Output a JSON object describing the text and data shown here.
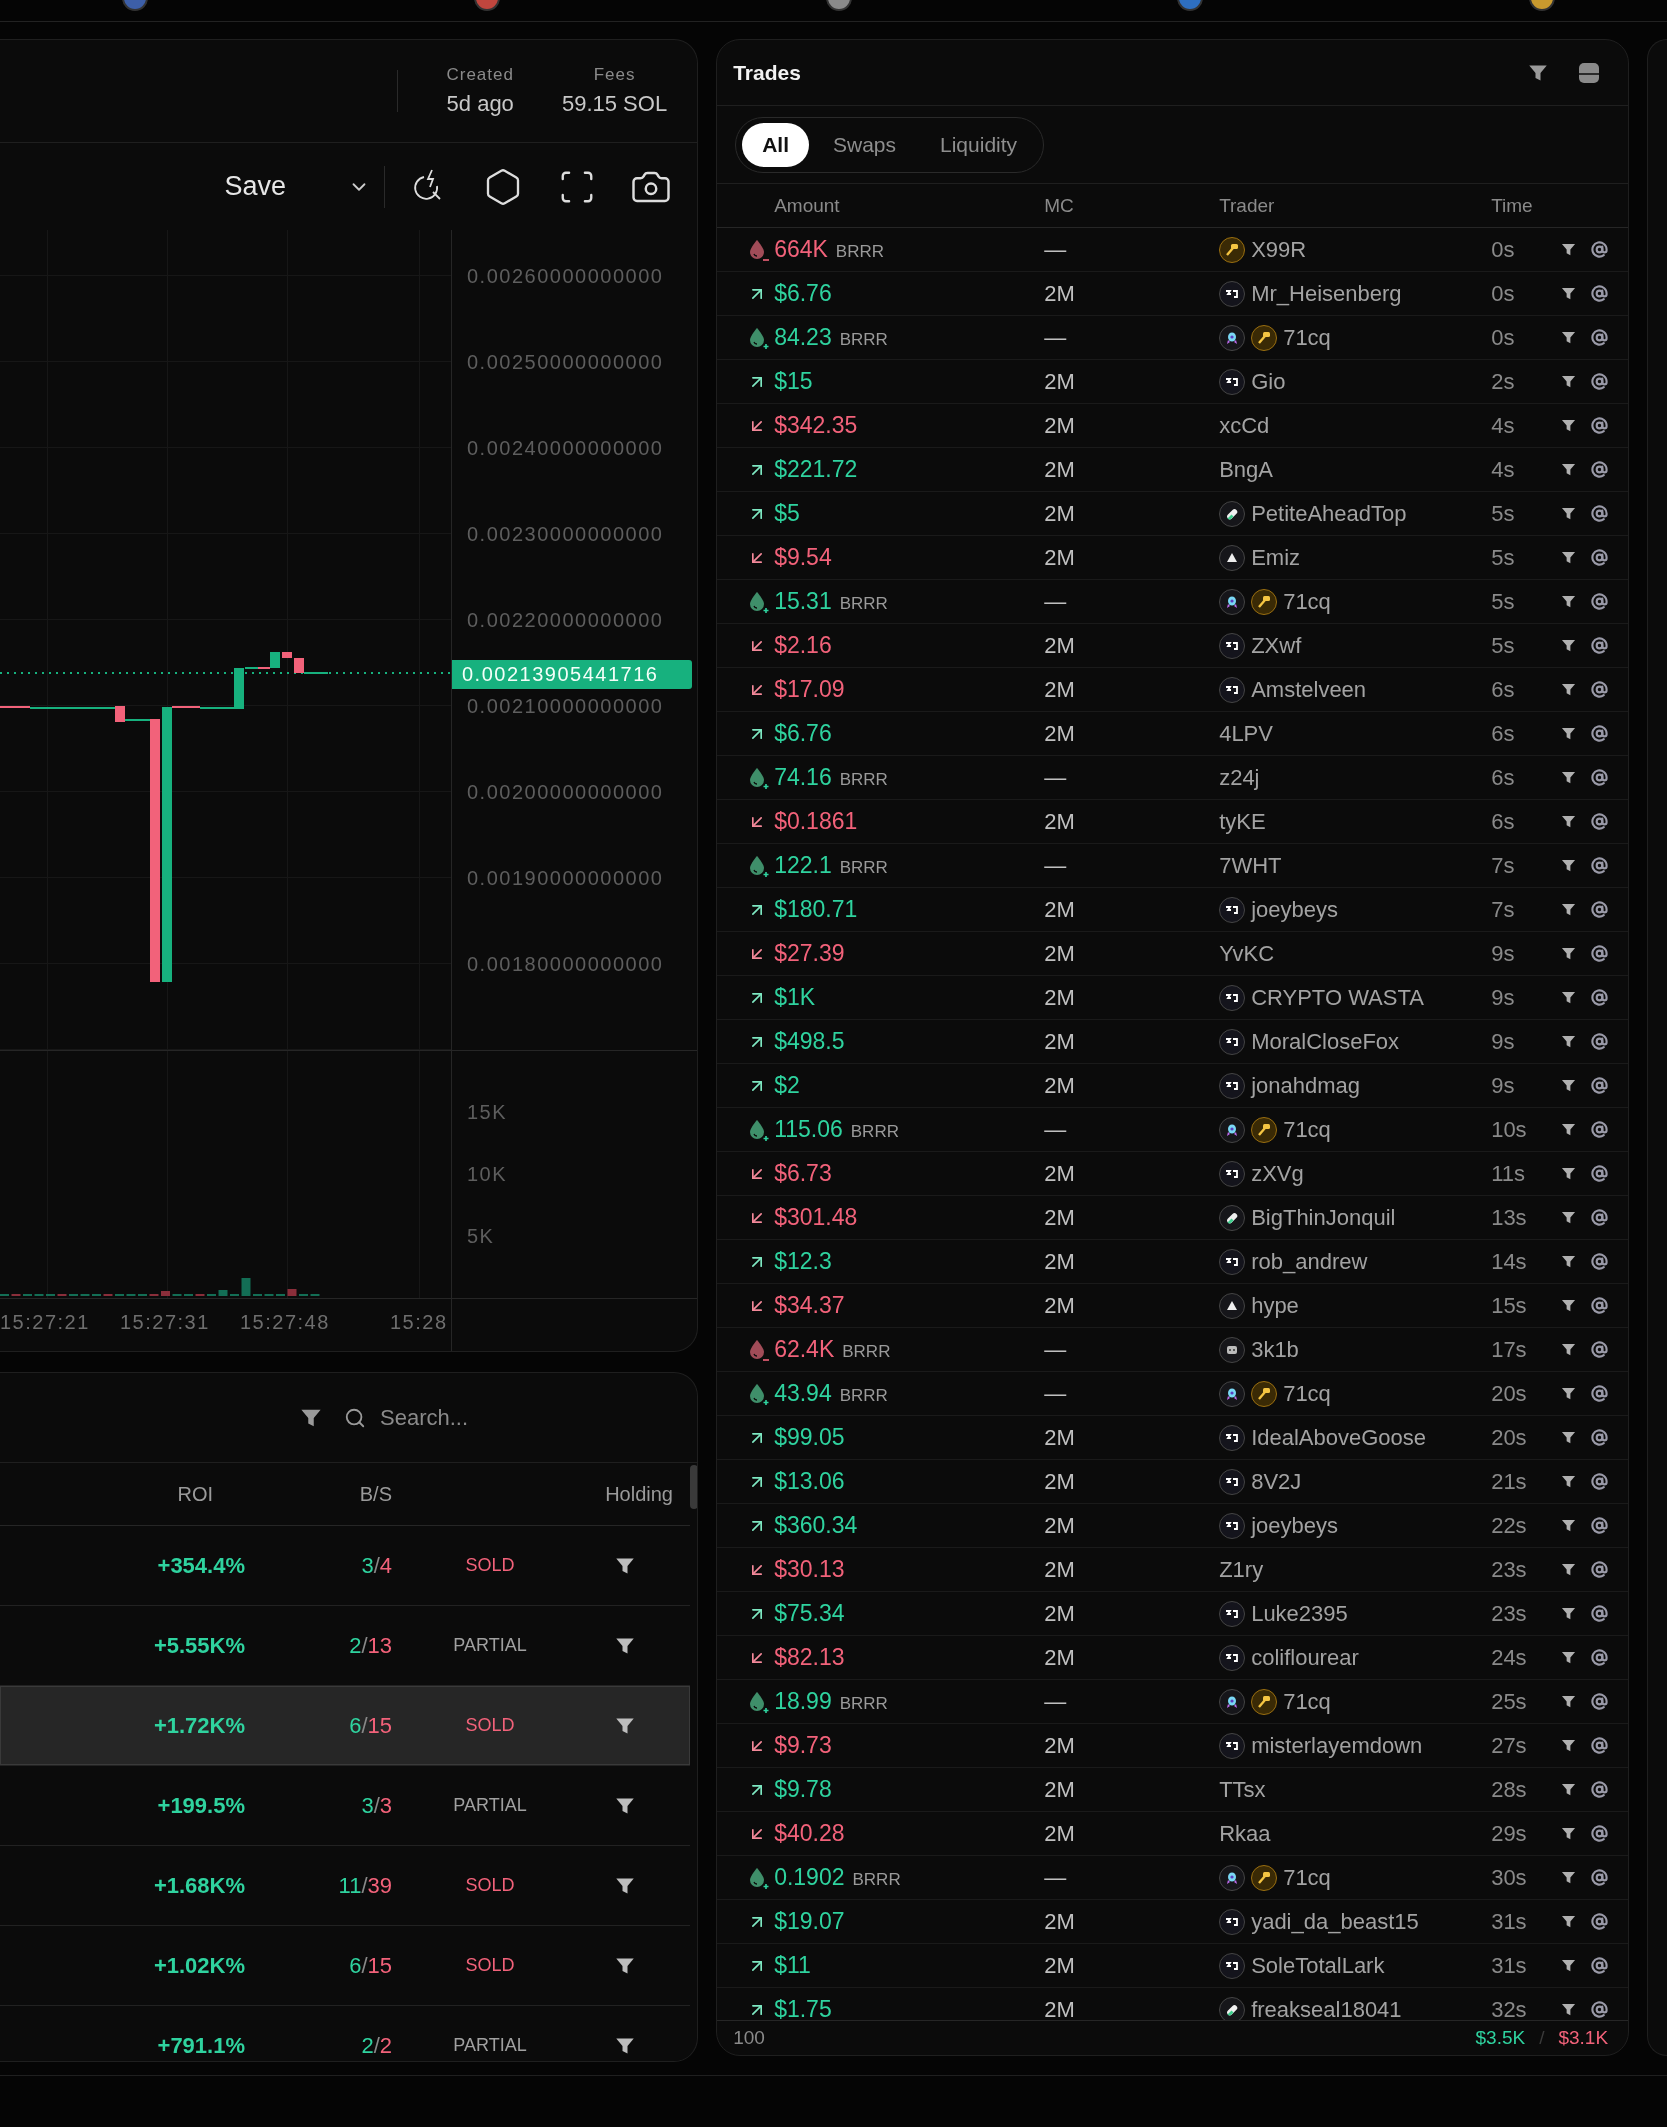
{
  "top_bar": {
    "token_icons": [
      {
        "color": "#3d5fa8"
      },
      {
        "color": "#c0463e"
      },
      {
        "color": "#8a8a8a"
      },
      {
        "color": "#2e6fc0"
      },
      {
        "color": "#c99a2e"
      }
    ]
  },
  "chart_header": {
    "stats": [
      {
        "label": "Created",
        "value": "5d ago"
      },
      {
        "label": "Fees",
        "value": "59.15 SOL"
      }
    ]
  },
  "chart_toolbar": {
    "save_label": "Save"
  },
  "price_chart": {
    "price_ticks": [
      "0.00260000000000",
      "0.00250000000000",
      "0.00240000000000",
      "0.00230000000000",
      "0.00220000000000",
      "0.00210000000000",
      "0.00200000000000",
      "0.00190000000000",
      "0.00180000000000"
    ],
    "current_price": "0.00213905441716",
    "volume_ticks": [
      "15K",
      "10K",
      "5K"
    ],
    "time_ticks": [
      "15:27:21",
      "15:27:31",
      "15:27:48",
      "15:28"
    ]
  },
  "holders": {
    "search": {
      "placeholder": "Search..."
    },
    "columns": [
      "ROI",
      "B/S",
      "Holding"
    ],
    "rows": [
      {
        "roi": "+354.4%",
        "buys": "3",
        "separator": "/",
        "sells": "4",
        "kind": "sold",
        "status": "SOLD",
        "highlighted": false
      },
      {
        "roi": "+5.55K%",
        "buys": "2",
        "separator": "/",
        "sells": "13",
        "kind": "partial",
        "status": "PARTIAL",
        "highlighted": false
      },
      {
        "roi": "+1.72K%",
        "buys": "6",
        "separator": "/",
        "sells": "15",
        "kind": "sold",
        "status": "SOLD",
        "highlighted": true
      },
      {
        "roi": "+199.5%",
        "buys": "3",
        "separator": "/",
        "sells": "3",
        "kind": "partial",
        "status": "PARTIAL",
        "highlighted": false
      },
      {
        "roi": "+1.68K%",
        "buys": "11",
        "separator": "/",
        "sells": "39",
        "kind": "sold",
        "status": "SOLD",
        "highlighted": false
      },
      {
        "roi": "+1.02K%",
        "buys": "6",
        "separator": "/",
        "sells": "15",
        "kind": "sold",
        "status": "SOLD",
        "highlighted": false
      },
      {
        "roi": "+791.1%",
        "buys": "2",
        "separator": "/",
        "sells": "2",
        "kind": "partial",
        "status": "PARTIAL",
        "highlighted": false
      }
    ]
  },
  "trades": {
    "title": "Trades",
    "tabs": [
      {
        "label": "All",
        "selected": true
      },
      {
        "label": "Swaps",
        "selected": false
      },
      {
        "label": "Liquidity",
        "selected": false
      }
    ],
    "columns": [
      "Amount",
      "MC",
      "Trader",
      "Time"
    ],
    "rows": [
      {
        "kind": "remove",
        "amount": "664K",
        "unit": "BRRR",
        "mc": "—",
        "badges": [
          {
            "kind": "key"
          }
        ],
        "trader": "X99R",
        "time": "0s"
      },
      {
        "kind": "buy",
        "amount": "$6.76",
        "mc": "2M",
        "badges": [
          {
            "kind": "pump"
          }
        ],
        "trader": "Mr_Heisenberg",
        "time": "0s"
      },
      {
        "kind": "add",
        "amount": "84.23",
        "unit": "BRRR",
        "mc": "—",
        "badges": [
          {
            "kind": "rocket"
          },
          {
            "kind": "key"
          }
        ],
        "trader": "71cq",
        "time": "0s"
      },
      {
        "kind": "buy",
        "amount": "$15",
        "mc": "2M",
        "badges": [
          {
            "kind": "pump"
          }
        ],
        "trader": "Gio",
        "time": "2s"
      },
      {
        "kind": "sell",
        "amount": "$342.35",
        "mc": "2M",
        "badges": [],
        "trader": "xcCd",
        "time": "4s"
      },
      {
        "kind": "buy",
        "amount": "$221.72",
        "mc": "2M",
        "badges": [],
        "trader": "BngA",
        "time": "4s"
      },
      {
        "kind": "buy",
        "amount": "$5",
        "mc": "2M",
        "badges": [
          {
            "kind": "pill"
          }
        ],
        "trader": "PetiteAheadTop",
        "time": "5s"
      },
      {
        "kind": "sell",
        "amount": "$9.54",
        "mc": "2M",
        "badges": [
          {
            "kind": "triangle"
          }
        ],
        "trader": "Emiz",
        "time": "5s"
      },
      {
        "kind": "add",
        "amount": "15.31",
        "unit": "BRRR",
        "mc": "—",
        "badges": [
          {
            "kind": "rocket"
          },
          {
            "kind": "key"
          }
        ],
        "trader": "71cq",
        "time": "5s"
      },
      {
        "kind": "sell",
        "amount": "$2.16",
        "mc": "2M",
        "badges": [
          {
            "kind": "pump"
          }
        ],
        "trader": "ZXwf",
        "time": "5s"
      },
      {
        "kind": "sell",
        "amount": "$17.09",
        "mc": "2M",
        "badges": [
          {
            "kind": "pump"
          }
        ],
        "trader": "Amstelveen",
        "time": "6s"
      },
      {
        "kind": "buy",
        "amount": "$6.76",
        "mc": "2M",
        "badges": [],
        "trader": "4LPV",
        "time": "6s"
      },
      {
        "kind": "add",
        "amount": "74.16",
        "unit": "BRRR",
        "mc": "—",
        "badges": [],
        "trader": "z24j",
        "time": "6s"
      },
      {
        "kind": "sell",
        "amount": "$0.1861",
        "mc": "2M",
        "badges": [],
        "trader": "tyKE",
        "time": "6s"
      },
      {
        "kind": "add",
        "amount": "122.1",
        "unit": "BRRR",
        "mc": "—",
        "badges": [],
        "trader": "7WHT",
        "time": "7s"
      },
      {
        "kind": "buy",
        "amount": "$180.71",
        "mc": "2M",
        "badges": [
          {
            "kind": "pump"
          }
        ],
        "trader": "joeybeys",
        "time": "7s"
      },
      {
        "kind": "sell",
        "amount": "$27.39",
        "mc": "2M",
        "badges": [],
        "trader": "YvKC",
        "time": "9s"
      },
      {
        "kind": "buy",
        "amount": "$1K",
        "mc": "2M",
        "badges": [
          {
            "kind": "pump"
          }
        ],
        "trader": "CRYPTO WASTA",
        "time": "9s"
      },
      {
        "kind": "buy",
        "amount": "$498.5",
        "mc": "2M",
        "badges": [
          {
            "kind": "pump"
          }
        ],
        "trader": "MoralCloseFox",
        "time": "9s"
      },
      {
        "kind": "buy",
        "amount": "$2",
        "mc": "2M",
        "badges": [
          {
            "kind": "pump"
          }
        ],
        "trader": "jonahdmag",
        "time": "9s"
      },
      {
        "kind": "add",
        "amount": "115.06",
        "unit": "BRRR",
        "mc": "—",
        "badges": [
          {
            "kind": "rocket"
          },
          {
            "kind": "key"
          }
        ],
        "trader": "71cq",
        "time": "10s"
      },
      {
        "kind": "sell",
        "amount": "$6.73",
        "mc": "2M",
        "badges": [
          {
            "kind": "pump"
          }
        ],
        "trader": "zXVg",
        "time": "11s"
      },
      {
        "kind": "sell",
        "amount": "$301.48",
        "mc": "2M",
        "badges": [
          {
            "kind": "pill"
          }
        ],
        "trader": "BigThinJonquil",
        "time": "13s"
      },
      {
        "kind": "buy",
        "amount": "$12.3",
        "mc": "2M",
        "badges": [
          {
            "kind": "pump"
          }
        ],
        "trader": "rob_andrew",
        "time": "14s"
      },
      {
        "kind": "sell",
        "amount": "$34.37",
        "mc": "2M",
        "badges": [
          {
            "kind": "triangle"
          }
        ],
        "trader": "hype",
        "time": "15s"
      },
      {
        "kind": "remove",
        "amount": "62.4K",
        "unit": "BRRR",
        "mc": "—",
        "badges": [
          {
            "kind": "robot"
          }
        ],
        "trader": "3k1b",
        "time": "17s"
      },
      {
        "kind": "add",
        "amount": "43.94",
        "unit": "BRRR",
        "mc": "—",
        "badges": [
          {
            "kind": "rocket"
          },
          {
            "kind": "key"
          }
        ],
        "trader": "71cq",
        "time": "20s"
      },
      {
        "kind": "buy",
        "amount": "$99.05",
        "mc": "2M",
        "badges": [
          {
            "kind": "pump"
          }
        ],
        "trader": "IdealAboveGoose",
        "time": "20s"
      },
      {
        "kind": "buy",
        "amount": "$13.06",
        "mc": "2M",
        "badges": [
          {
            "kind": "pump"
          }
        ],
        "trader": "8V2J",
        "time": "21s"
      },
      {
        "kind": "buy",
        "amount": "$360.34",
        "mc": "2M",
        "badges": [
          {
            "kind": "pump"
          }
        ],
        "trader": "joeybeys",
        "time": "22s"
      },
      {
        "kind": "sell",
        "amount": "$30.13",
        "mc": "2M",
        "badges": [],
        "trader": "Z1ry",
        "time": "23s"
      },
      {
        "kind": "buy",
        "amount": "$75.34",
        "mc": "2M",
        "badges": [
          {
            "kind": "pump"
          }
        ],
        "trader": "Luke2395",
        "time": "23s"
      },
      {
        "kind": "sell",
        "amount": "$82.13",
        "mc": "2M",
        "badges": [
          {
            "kind": "pump"
          }
        ],
        "trader": "coliflourear",
        "time": "24s"
      },
      {
        "kind": "add",
        "amount": "18.99",
        "unit": "BRRR",
        "mc": "—",
        "badges": [
          {
            "kind": "rocket"
          },
          {
            "kind": "key"
          }
        ],
        "trader": "71cq",
        "time": "25s"
      },
      {
        "kind": "sell",
        "amount": "$9.73",
        "mc": "2M",
        "badges": [
          {
            "kind": "pump"
          }
        ],
        "trader": "misterlayemdown",
        "time": "27s"
      },
      {
        "kind": "buy",
        "amount": "$9.78",
        "mc": "2M",
        "badges": [],
        "trader": "TTsx",
        "time": "28s"
      },
      {
        "kind": "sell",
        "amount": "$40.28",
        "mc": "2M",
        "badges": [],
        "trader": "Rkaa",
        "time": "29s"
      },
      {
        "kind": "add",
        "amount": "0.1902",
        "unit": "BRRR",
        "mc": "—",
        "badges": [
          {
            "kind": "rocket"
          },
          {
            "kind": "key"
          }
        ],
        "trader": "71cq",
        "time": "30s"
      },
      {
        "kind": "buy",
        "amount": "$19.07",
        "mc": "2M",
        "badges": [
          {
            "kind": "pump"
          }
        ],
        "trader": "yadi_da_beast15",
        "time": "31s"
      },
      {
        "kind": "buy",
        "amount": "$11",
        "mc": "2M",
        "badges": [
          {
            "kind": "pump"
          }
        ],
        "trader": "SoleTotalLark",
        "time": "31s"
      },
      {
        "kind": "buy",
        "amount": "$1.75",
        "mc": "2M",
        "badges": [
          {
            "kind": "pill"
          }
        ],
        "trader": "freakseal18041",
        "time": "32s"
      }
    ],
    "footer": {
      "count": "100",
      "buy_total": "$3.5K",
      "separator": "/",
      "sell_total": "$3.1K"
    }
  }
}
